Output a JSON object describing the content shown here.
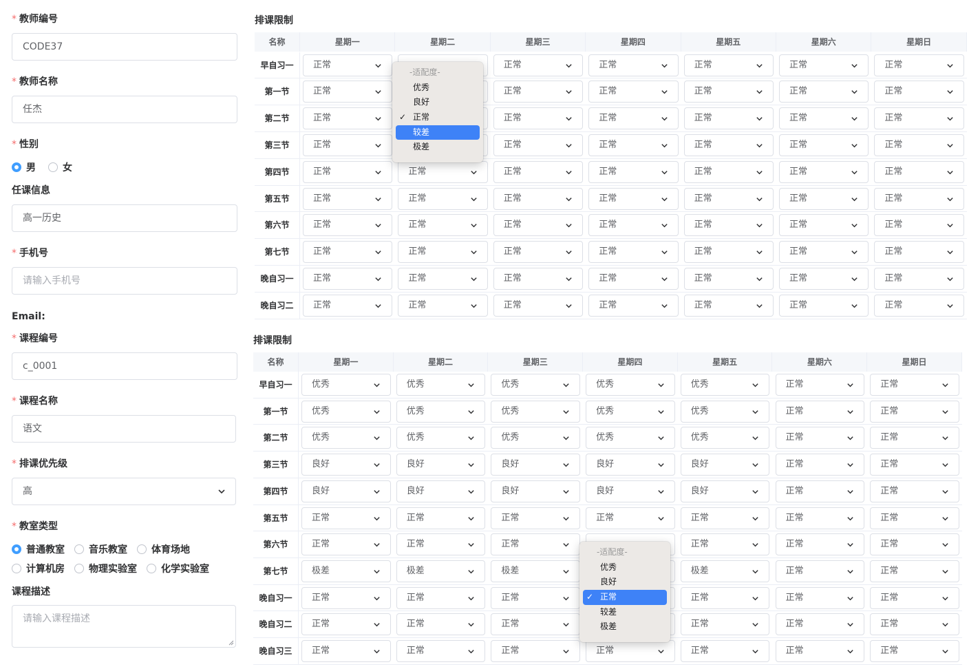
{
  "form": {
    "teacher_id": {
      "label": "教师编号",
      "value": "CODE37"
    },
    "teacher_name": {
      "label": "教师名称",
      "value": "任杰"
    },
    "gender": {
      "label": "性别",
      "options": [
        "男",
        "女"
      ],
      "selected": 0
    },
    "course_info": {
      "label": "任课信息",
      "value": "高一历史"
    },
    "phone": {
      "label": "手机号",
      "placeholder": "请输入手机号"
    },
    "email": {
      "label": "Email:"
    },
    "course_id": {
      "label": "课程编号",
      "value": "c_0001"
    },
    "course_name": {
      "label": "课程名称",
      "value": "语文"
    },
    "priority": {
      "label": "排课优先级",
      "value": "高"
    },
    "room_type": {
      "label": "教室类型",
      "options": [
        "普通教室",
        "音乐教室",
        "体育场地",
        "计算机房",
        "物理实验室",
        "化学实验室"
      ],
      "selected": 0
    },
    "course_desc": {
      "label": "课程描述",
      "placeholder": "请输入课程描述"
    }
  },
  "schedule_top": {
    "title": "排课限制",
    "name_header": "名称",
    "days": [
      "星期一",
      "星期二",
      "星期三",
      "星期四",
      "星期五",
      "星期六",
      "星期日"
    ],
    "rows": [
      {
        "name": "早自习一",
        "values": [
          "正常",
          "",
          "正常",
          "正常",
          "正常",
          "正常",
          "正常"
        ]
      },
      {
        "name": "第一节",
        "values": [
          "正常",
          "",
          "正常",
          "正常",
          "正常",
          "正常",
          "正常"
        ]
      },
      {
        "name": "第二节",
        "values": [
          "正常",
          "",
          "正常",
          "正常",
          "正常",
          "正常",
          "正常"
        ]
      },
      {
        "name": "第三节",
        "values": [
          "正常",
          "",
          "正常",
          "正常",
          "正常",
          "正常",
          "正常"
        ]
      },
      {
        "name": "第四节",
        "values": [
          "正常",
          "正常",
          "正常",
          "正常",
          "正常",
          "正常",
          "正常"
        ]
      },
      {
        "name": "第五节",
        "values": [
          "正常",
          "正常",
          "正常",
          "正常",
          "正常",
          "正常",
          "正常"
        ]
      },
      {
        "name": "第六节",
        "values": [
          "正常",
          "正常",
          "正常",
          "正常",
          "正常",
          "正常",
          "正常"
        ]
      },
      {
        "name": "第七节",
        "values": [
          "正常",
          "正常",
          "正常",
          "正常",
          "正常",
          "正常",
          "正常"
        ]
      },
      {
        "name": "晚自习一",
        "values": [
          "正常",
          "正常",
          "正常",
          "正常",
          "正常",
          "正常",
          "正常"
        ]
      },
      {
        "name": "晚自习二",
        "values": [
          "正常",
          "正常",
          "正常",
          "正常",
          "正常",
          "正常",
          "正常"
        ]
      }
    ],
    "dropdown": {
      "placeholder": "-适配度-",
      "options": [
        "优秀",
        "良好",
        "正常",
        "较差",
        "极差"
      ],
      "checked": 2,
      "highlighted": 3
    }
  },
  "schedule_bottom": {
    "title": "排课限制",
    "name_header": "名称",
    "days": [
      "星期一",
      "星期二",
      "星期三",
      "星期四",
      "星期五",
      "星期六",
      "星期日"
    ],
    "rows": [
      {
        "name": "早自习一",
        "values": [
          "优秀",
          "优秀",
          "优秀",
          "优秀",
          "优秀",
          "正常",
          "正常"
        ]
      },
      {
        "name": "第一节",
        "values": [
          "优秀",
          "优秀",
          "优秀",
          "优秀",
          "优秀",
          "正常",
          "正常"
        ]
      },
      {
        "name": "第二节",
        "values": [
          "优秀",
          "优秀",
          "优秀",
          "优秀",
          "优秀",
          "正常",
          "正常"
        ]
      },
      {
        "name": "第三节",
        "values": [
          "良好",
          "良好",
          "良好",
          "良好",
          "良好",
          "正常",
          "正常"
        ]
      },
      {
        "name": "第四节",
        "values": [
          "良好",
          "良好",
          "良好",
          "良好",
          "良好",
          "正常",
          "正常"
        ]
      },
      {
        "name": "第五节",
        "values": [
          "正常",
          "正常",
          "正常",
          "正常",
          "正常",
          "正常",
          "正常"
        ]
      },
      {
        "name": "第六节",
        "values": [
          "正常",
          "正常",
          "正常",
          "",
          "正常",
          "正常",
          "正常"
        ]
      },
      {
        "name": "第七节",
        "values": [
          "极差",
          "极差",
          "极差",
          "",
          "极差",
          "正常",
          "正常"
        ]
      },
      {
        "name": "晚自习一",
        "values": [
          "正常",
          "正常",
          "正常",
          "",
          "正常",
          "正常",
          "正常"
        ]
      },
      {
        "name": "晚自习二",
        "values": [
          "正常",
          "正常",
          "正常",
          "",
          "正常",
          "正常",
          "正常"
        ]
      },
      {
        "name": "晚自习三",
        "values": [
          "正常",
          "正常",
          "正常",
          "正常",
          "正常",
          "正常",
          "正常"
        ]
      }
    ],
    "dropdown": {
      "placeholder": "-适配度-",
      "options": [
        "优秀",
        "良好",
        "正常",
        "较差",
        "极差"
      ],
      "checked": 2,
      "highlighted": 2
    }
  },
  "colors": {
    "accent": "#409eff",
    "required": "#f56c6c",
    "menu_highlight": "#3e82f7"
  }
}
